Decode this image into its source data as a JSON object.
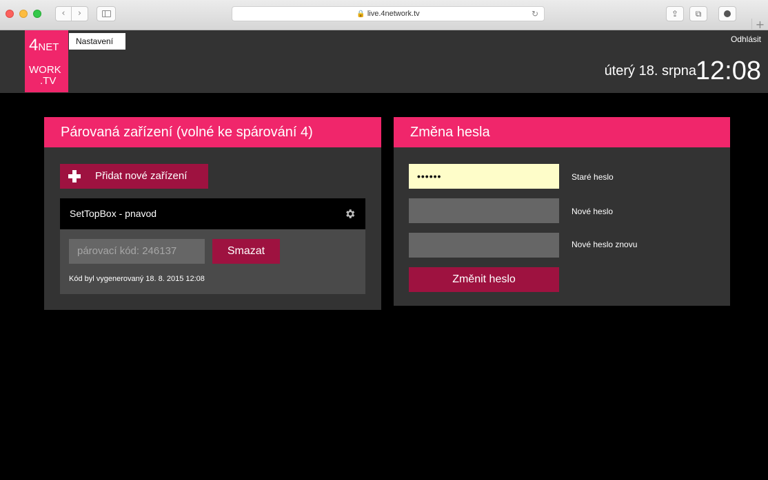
{
  "browser": {
    "url": "live.4network.tv",
    "back_glyph": "‹",
    "forward_glyph": "›",
    "reload_glyph": "↻",
    "share_glyph": "⇪",
    "tabs_glyph": "⧉",
    "newtab_glyph": "+"
  },
  "header": {
    "tab_label": "Nastavení",
    "logout_label": "Odhlásit",
    "date": "úterý 18. srpna",
    "time": "12:08"
  },
  "logo": {
    "num": "4",
    "net": "NET",
    "work": "WORK",
    "tv": ".TV"
  },
  "devices_panel": {
    "title": "Párovaná zařízení (volné ke spárování 4)",
    "add_label": "Přidat nové zařízení",
    "device": {
      "name": "SetTopBox - pnavod",
      "pair_code": "párovací kód: 246137",
      "delete_label": "Smazat",
      "generated_note": "Kód byl vygenerovaný 18. 8. 2015 12:08"
    }
  },
  "password_panel": {
    "title": "Změna hesla",
    "old_value": "••••••",
    "old_label": "Staré heslo",
    "new_value": "",
    "new_label": "Nové heslo",
    "repeat_value": "",
    "repeat_label": "Nové heslo znovu",
    "submit_label": "Změnit heslo"
  },
  "colors": {
    "accent": "#f0266b",
    "button": "#9e1240",
    "panel": "#333333",
    "background": "#000000"
  }
}
